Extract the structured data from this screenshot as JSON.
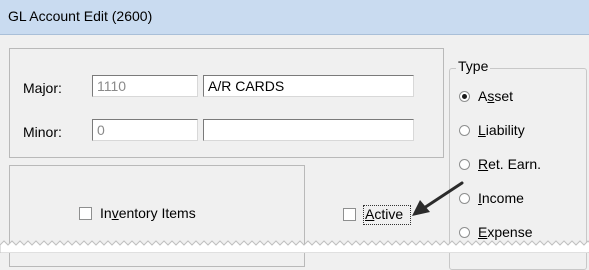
{
  "window": {
    "title": "GL Account Edit (2600)"
  },
  "account": {
    "major_label": "Major:",
    "major_number": "1110",
    "major_name": "A/R CARDS",
    "minor_label": "Minor:",
    "minor_number": "0",
    "minor_name": ""
  },
  "type_group": {
    "legend": "Type",
    "options": [
      {
        "pre": "A",
        "accel": "s",
        "post": "set",
        "selected": true
      },
      {
        "pre": "",
        "accel": "L",
        "post": "iability",
        "selected": false
      },
      {
        "pre": "",
        "accel": "R",
        "post": "et. Earn.",
        "selected": false
      },
      {
        "pre": "",
        "accel": "I",
        "post": "ncome",
        "selected": false
      },
      {
        "pre": "",
        "accel": "E",
        "post": "xpense",
        "selected": false
      }
    ]
  },
  "inventory_items": {
    "pre": "In",
    "accel": "v",
    "post": "entory Items",
    "checked": false
  },
  "active": {
    "pre": "",
    "accel": "A",
    "post": "ctive",
    "checked": false
  },
  "colors": {
    "titlebar": "#c9dbf0",
    "background": "#f0f0f0",
    "arrow": "#2b2b2b"
  }
}
